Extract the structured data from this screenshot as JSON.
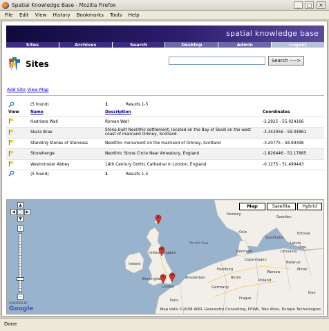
{
  "window": {
    "title": "Spatial Knowledge Base - Mozilla Firefox",
    "minimize": "_",
    "maximize": "□",
    "close": "×"
  },
  "menu": [
    "File",
    "Edit",
    "View",
    "History",
    "Bookmarks",
    "Tools",
    "Help"
  ],
  "banner": {
    "brand": "spatial knowledge base"
  },
  "nav": [
    "Sites",
    "Archives",
    "Search",
    "Desktop",
    "Admin",
    "Logout"
  ],
  "page": {
    "heading": "Sites"
  },
  "search": {
    "value": "",
    "button": "Search ---->"
  },
  "links": {
    "add_site": "Add Site",
    "view_map": "View Map"
  },
  "table": {
    "pager_top": {
      "found": "(5 found)",
      "page": "1",
      "results": "Results 1-5"
    },
    "columns": {
      "view": "View",
      "name": "Name",
      "description": "Description",
      "coordinates": "Coordinates"
    },
    "rows": [
      {
        "name": "Hadrians Wall",
        "description": "Roman Wall",
        "coordinates": "-2.2925 - 55.024166"
      },
      {
        "name": "Skara Brae",
        "description": "Stone-built Neolithic settlement, located on the Bay of Skaill on the west coast of mainland Orkney, Scotland.",
        "coordinates": "-3.343056 - 59.04861"
      },
      {
        "name": "Standing Stones of Stenness",
        "description": "Neolithic monument on the mainland of Orkney, Scotland",
        "coordinates": "-3.20775 - 58.99398"
      },
      {
        "name": "Stonehenge",
        "description": "Neolithic Stone Circle Near Amesbury, England",
        "coordinates": "-1.826446 - 51.17885"
      },
      {
        "name": "Westminster Abbey",
        "description": "14th Century Gothic Cathedral in London, England",
        "coordinates": "-0.1275 - 51.499443"
      }
    ],
    "pager_bottom": {
      "found": "(5 found)",
      "page": "1",
      "results": "Results 1-5"
    }
  },
  "map": {
    "types": [
      "Map",
      "Satellite",
      "Hybrid"
    ],
    "active_type": "Map",
    "copyright": "Map data ©2008 AND, Geocentre Consulting, PPWK, Tele Atlas, Europa Technologies",
    "powered_by": "POWERED BY",
    "logo": "Google",
    "labels": {
      "uk": "United Kingdom",
      "ireland": "Ireland",
      "birmingham": "Birmingham",
      "london": "London",
      "paris": "Paris",
      "sweden": "Sweden",
      "denmark": "Denmark",
      "germany": "Germany",
      "poland": "Poland",
      "belarus": "Belarus",
      "berlin": "Berlin",
      "latvia": "Latvia",
      "lithuania": "Lithuania",
      "estonia": "Estonia",
      "riga": "Riga",
      "minsk": "Minsk",
      "hamburg": "Hamburg",
      "copenhagen": "Copenhagen",
      "oslo": "Oslo",
      "stockholm": "Stockholm",
      "norway": "Norway",
      "north_sea": "North Sea",
      "amsterdam": "Amsterdam",
      "prague": "Prague",
      "warsaw": "Warsaw",
      "kiev": "Kiev"
    }
  },
  "status": "Done"
}
